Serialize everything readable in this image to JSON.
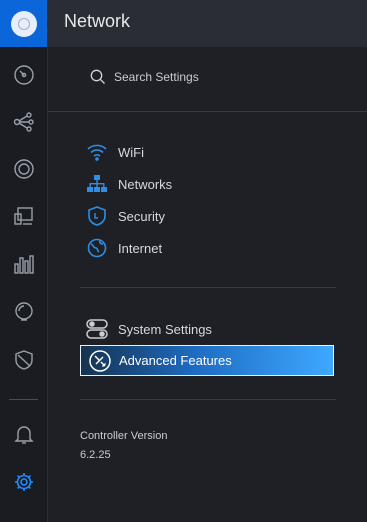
{
  "header": {
    "title": "Network"
  },
  "search": {
    "placeholder": "Search Settings"
  },
  "menu": {
    "primary": [
      {
        "label": "WiFi",
        "icon": "wifi-icon"
      },
      {
        "label": "Networks",
        "icon": "network-topology-icon"
      },
      {
        "label": "Security",
        "icon": "security-shield-icon"
      },
      {
        "label": "Internet",
        "icon": "globe-icon"
      }
    ],
    "secondary": [
      {
        "label": "System Settings",
        "icon": "toggles-icon"
      },
      {
        "label": "Advanced Features",
        "icon": "tools-icon",
        "selected": true
      }
    ]
  },
  "controller": {
    "version_label": "Controller Version",
    "version_value": "6.2.25"
  },
  "sidebar": {
    "icons": [
      "dashboard-icon",
      "topology-icon",
      "devices-icon",
      "clients-icon",
      "statistics-icon",
      "insights-icon",
      "threat-shield-icon",
      "alerts-bell-icon",
      "settings-gear-icon"
    ],
    "active": "settings-gear-icon"
  },
  "colors": {
    "accent": "#0a66d9",
    "selection_start": "#16324f",
    "selection_end": "#3ea9ff",
    "icon_blue": "#2f8de4"
  }
}
